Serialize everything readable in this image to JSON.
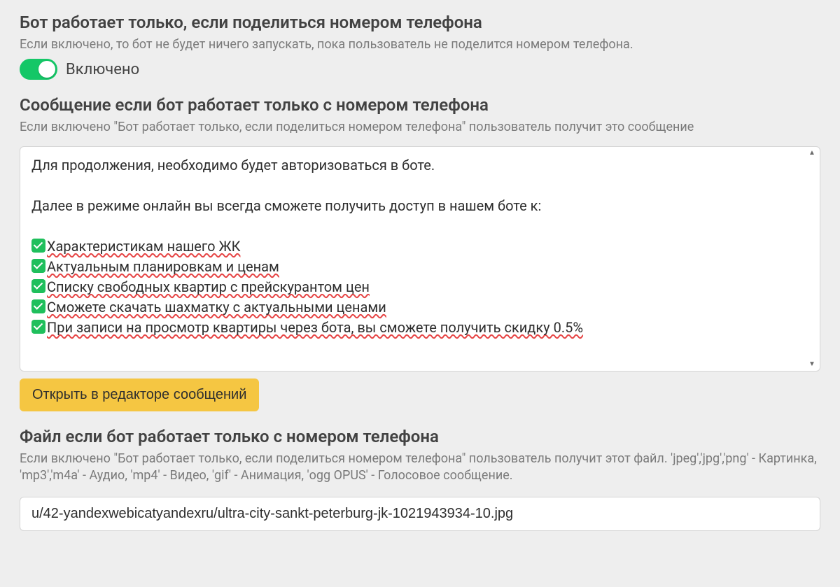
{
  "section1": {
    "title": "Бот работает только, если поделиться номером телефона",
    "subtitle": "Если включено, то бот не будет ничего запускать, пока пользователь не поделится номером телефона.",
    "toggle_on": true,
    "toggle_label": "Включено"
  },
  "section2": {
    "title": "Сообщение если бот работает только с номером телефона",
    "subtitle": "Если включено \"Бот работает только, если поделиться номером телефона\" пользователь получит это сообщение",
    "message": {
      "line1": "Для продолжения, необходимо будет авторизоваться в боте.",
      "line2": "Далее в режиме онлайн вы всегда сможете получить доступ в нашем боте к:",
      "items": [
        "Характеристикам нашего ЖК",
        "Актуальным планировкам и ценам",
        "Списку свободных квартир с прейскурантом цен",
        "Сможете скачать шахматку с актуальными ценами",
        "При записи на просмотр квартиры через бота, вы сможете получить скидку 0.5%"
      ]
    },
    "open_editor_label": "Открыть в редакторе сообщений"
  },
  "section3": {
    "title": "Файл если бот работает только с номером телефона",
    "subtitle": "Если включено \"Бот работает только, если поделиться номером телефона\" пользователь получит этот файл. 'jpeg','jpg','png' - Картинка, 'mp3','m4a' - Аудио, 'mp4' - Видео, 'gif' - Анимация, 'ogg OPUS' - Голосовое сообщение.",
    "file_value": "u/42-yandexwebicatyandexru/ultra-city-sankt-peterburg-jk-1021943934-10.jpg"
  }
}
